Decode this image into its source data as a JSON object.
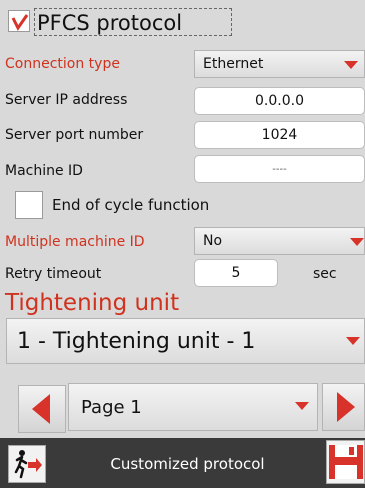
{
  "header": {
    "title": "PFCS protocol",
    "enabled": true
  },
  "connection_type": {
    "label": "Connection type",
    "value": "Ethernet"
  },
  "server_ip": {
    "label": "Server IP address",
    "value": "0.0.0.0"
  },
  "server_port": {
    "label": "Server port number",
    "value": "1024"
  },
  "machine_id": {
    "label": "Machine ID",
    "value": "----"
  },
  "end_of_cycle": {
    "label": "End of cycle function",
    "checked": false
  },
  "multiple_machine_id": {
    "label": "Multiple machine ID",
    "value": "No"
  },
  "retry_timeout": {
    "label": "Retry timeout",
    "value": "5",
    "unit": "sec"
  },
  "tightening": {
    "heading": "Tightening unit",
    "selected": "1 - Tightening unit - 1"
  },
  "pager": {
    "value": "Page 1"
  },
  "footer": {
    "title": "Customized protocol"
  },
  "colors": {
    "accent_red": "#d0321e",
    "footer_bg": "#3a3a3a",
    "background": "#d9d9d9"
  }
}
